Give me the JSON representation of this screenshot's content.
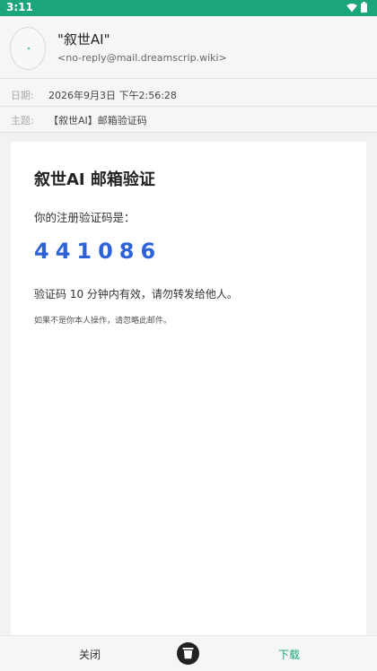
{
  "status_bar": {
    "time": "3:11"
  },
  "header": {
    "sender_name": "\"叙世AI\"",
    "sender_email": "<no-reply@mail.dreamscrip.wiki>",
    "date_label": "日期:",
    "date_value": "2026年9月3日 下午2:56:28",
    "subject_label": "主题:",
    "subject_value": "【叙世AI】邮箱验证码"
  },
  "email": {
    "title": "叙世AI 邮箱验证",
    "intro": "你的注册验证码是：",
    "code": "441086",
    "validity": "验证码 10 分钟内有效，请勿转发给他人。",
    "note": "如果不是你本人操作，请忽略此邮件。"
  },
  "bottom_bar": {
    "close_label": "关闭",
    "download_label": "下载"
  },
  "colors": {
    "accent": "#1aa67a",
    "code": "#2e62d9"
  },
  "icons": [
    "wifi-icon",
    "battery-icon",
    "trash-icon"
  ]
}
